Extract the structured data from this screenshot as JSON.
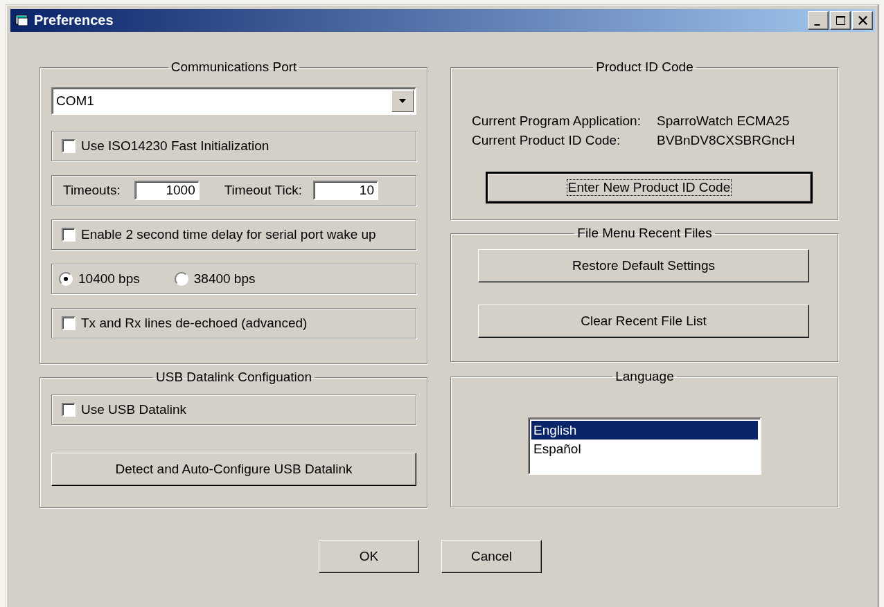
{
  "window": {
    "title": "Preferences"
  },
  "communications_port": {
    "title": "Communications Port",
    "port": "COM1",
    "rows": [
      {
        "kind": "checkbox",
        "label": "Use ISO14230 Fast Initialization",
        "checked": false
      },
      {
        "kind": "timeouts",
        "timeouts_label": "Timeouts:",
        "timeouts_value": "1000",
        "tick_label": "Timeout Tick:",
        "tick_value": "10"
      },
      {
        "kind": "checkbox",
        "label": "Enable 2 second time delay for serial port wake up",
        "checked": false
      },
      {
        "kind": "radios",
        "options": [
          {
            "label": "10400 bps",
            "selected": true
          },
          {
            "label": "38400 bps",
            "selected": false
          }
        ]
      },
      {
        "kind": "checkbox",
        "label": "Tx and Rx lines de-echoed (advanced)",
        "checked": false
      }
    ]
  },
  "usb_datalink": {
    "title": "USB Datalink Configuation",
    "checkbox": {
      "label": "Use USB Datalink",
      "checked": false
    },
    "button": "Detect and Auto-Configure USB Datalink"
  },
  "product_id": {
    "title": "Product ID Code",
    "rows": [
      {
        "label": "Current Program Application:",
        "value": "SparroWatch ECMA25"
      },
      {
        "label": "Current Product ID Code:",
        "value": "BVBnDV8CXSBRGncH"
      }
    ],
    "button": "Enter New Product ID Code"
  },
  "recent_files": {
    "title": "File Menu Recent Files",
    "buttons": [
      "Restore Default Settings",
      "Clear Recent File List"
    ]
  },
  "language": {
    "title": "Language",
    "items": [
      {
        "label": "English",
        "selected": true
      },
      {
        "label": "Español",
        "selected": false
      }
    ]
  },
  "buttons": [
    "OK",
    "Cancel"
  ]
}
